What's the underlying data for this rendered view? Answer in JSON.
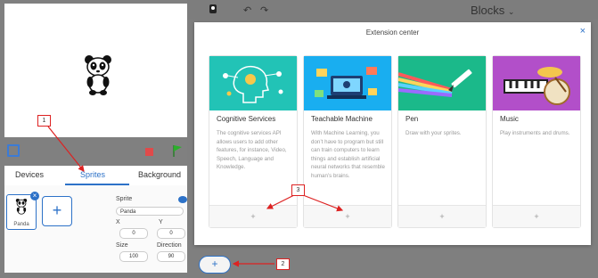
{
  "stage_tabs": {
    "devices": "Devices",
    "sprites": "Sprites",
    "background": "Background"
  },
  "sprite_list": {
    "items": [
      {
        "name": "Panda"
      }
    ],
    "add_label": "+"
  },
  "sprite_props": {
    "sprite_label": "Sprite",
    "sprite_value": "Panda",
    "x_label": "X",
    "x_value": "0",
    "y_label": "Y",
    "y_value": "0",
    "size_label": "Size",
    "size_value": "100",
    "direction_label": "Direction",
    "direction_value": "90"
  },
  "editor": {
    "title": "Blocks",
    "undo_icon": "undo-icon",
    "redo_icon": "redo-icon",
    "add_extension_label": "+"
  },
  "extension_center": {
    "title": "Extension center",
    "close_label": "×",
    "cards": [
      {
        "title": "Cognitive Services",
        "description": "The cognitive services API allows users to add other features, for instance, Video, Speech, Language and Knowledge.",
        "add_label": "+",
        "image_color": "#22c3b6"
      },
      {
        "title": "Teachable Machine",
        "description": "With Machine Learning, you don’t have to program but still can train computers to learn things and establish artificial neural networks that resemble human’s brains.",
        "add_label": "+",
        "image_color": "#19aef0"
      },
      {
        "title": "Pen",
        "description": "Draw with your sprites.",
        "add_label": "+",
        "image_color": "#1bb98a"
      },
      {
        "title": "Music",
        "description": "Play instruments and drums.",
        "add_label": "+",
        "image_color": "#b24fc9"
      }
    ]
  },
  "annotations": {
    "one": "1",
    "two": "2",
    "three": "3",
    "color": "#dd2222"
  }
}
